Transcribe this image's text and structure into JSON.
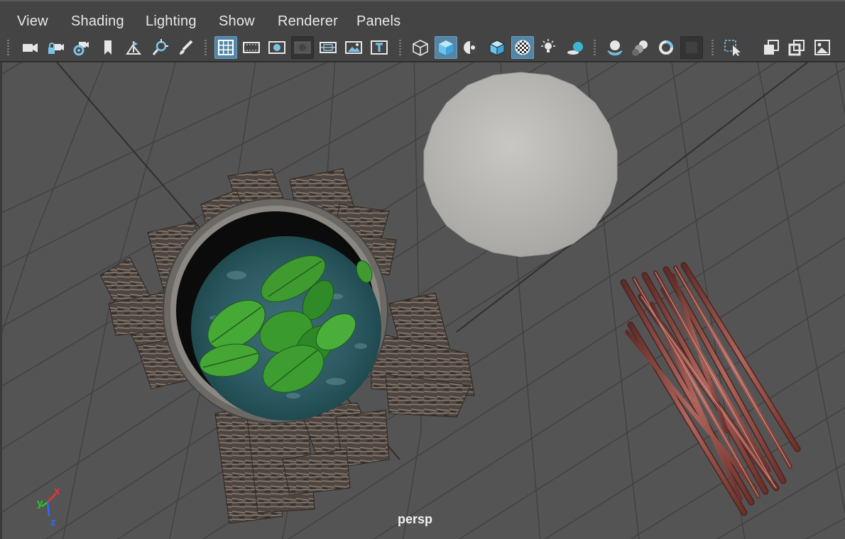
{
  "menu": {
    "items": [
      {
        "id": "view",
        "label": "View"
      },
      {
        "id": "shading",
        "label": "Shading"
      },
      {
        "id": "lighting",
        "label": "Lighting"
      },
      {
        "id": "show",
        "label": "Show"
      },
      {
        "id": "renderer",
        "label": "Renderer"
      },
      {
        "id": "panels",
        "label": "Panels"
      }
    ]
  },
  "toolbar": {
    "icons": [
      "camera-select-icon",
      "lock-camera-icon",
      "camera-attributes-icon",
      "bookmark-icon",
      "image-plane-icon",
      "two-d-pan-zoom-icon",
      "grease-pencil-icon",
      "grid-icon",
      "film-gate-icon",
      "resolution-gate-icon",
      "gate-mask-icon",
      "field-chart-icon",
      "safe-action-icon",
      "safe-title-icon",
      "wireframe-icon",
      "smooth-shade-icon",
      "wireframe-on-shaded-icon",
      "textured-icon",
      "use-default-material-icon",
      "all-lights-icon",
      "shadows-icon",
      "ambient-occlusion-icon",
      "motion-blur-icon",
      "anti-aliasing-icon",
      "depth-of-field-icon",
      "isolate-select-icon",
      "xray-icon",
      "xray-active-components-icon",
      "xray-joints-icon"
    ],
    "active": [
      "grid-icon",
      "smooth-shade-icon",
      "textured-icon"
    ]
  },
  "viewport": {
    "camera": "persp",
    "axis": {
      "x": "x",
      "y": "y",
      "z": "z"
    }
  },
  "colors": {
    "background": "#545454",
    "grid": "#3f3f3f",
    "highlight": "#5285a6",
    "axis_x": "#e33",
    "axis_y": "#2c2",
    "axis_z": "#36f"
  }
}
